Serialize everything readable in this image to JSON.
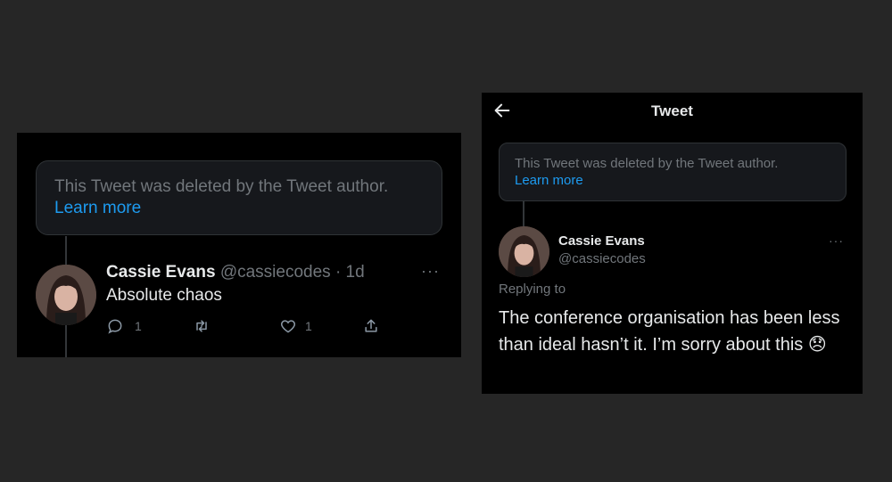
{
  "left": {
    "deleted": {
      "message": "This Tweet was deleted by the Tweet author.",
      "link": "Learn more"
    },
    "tweet": {
      "name": "Cassie Evans",
      "handle": "@cassiecodes",
      "time": "· 1d",
      "text": "Absolute chaos",
      "reply_count": "1",
      "like_count": "1",
      "more": "···"
    }
  },
  "right": {
    "header_title": "Tweet",
    "deleted": {
      "message": "This Tweet was deleted by the Tweet author.",
      "link": "Learn more"
    },
    "tweet": {
      "name": "Cassie Evans",
      "handle": "@cassiecodes",
      "replying_to": "Replying to",
      "text": "The conference organisation has been less than ideal hasn’t it. I’m sorry about this 😞",
      "more": "···"
    }
  },
  "icons": [
    "back-arrow-icon",
    "reply-icon",
    "retweet-icon",
    "like-icon",
    "share-icon",
    "more-icon"
  ],
  "colors": {
    "background": "#262626",
    "panel": "#000000",
    "link": "#1d9bf0",
    "muted": "#71767b",
    "text": "#e7e9ea"
  }
}
